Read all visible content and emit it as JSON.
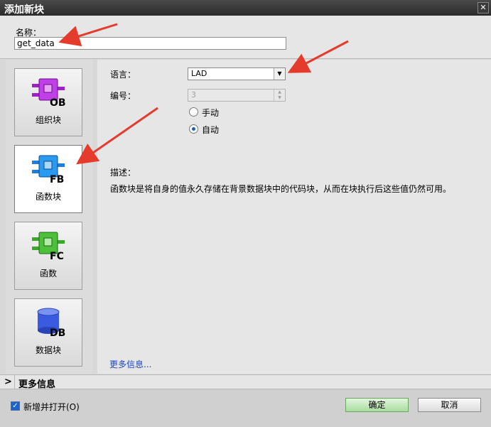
{
  "dialog": {
    "title": "添加新块",
    "close_glyph": "✕"
  },
  "name": {
    "label": "名称：",
    "value": "get_data"
  },
  "blocks": [
    {
      "label": "组织块",
      "code": "OB",
      "color": "#a020c8"
    },
    {
      "label": "函数块",
      "code": "FB",
      "color": "#1e7ee0",
      "selected": true
    },
    {
      "label": "函数",
      "code": "FC",
      "color": "#3aa82a"
    },
    {
      "label": "数据块",
      "code": "DB",
      "color": "#3a5ae0"
    }
  ],
  "form": {
    "language_label": "语言：",
    "language_value": "LAD",
    "number_label": "编号：",
    "number_value": "3",
    "manual_label": "手动",
    "auto_label": "自动",
    "selected_mode": "auto"
  },
  "description": {
    "label": "描述：",
    "text": "函数块是将自身的值永久存储在背景数据块中的代码块，从而在块执行后这些值仍然可用。"
  },
  "more_info_link": "更多信息...",
  "more_info_bar": {
    "chevron": ">",
    "title": "更多信息"
  },
  "footer": {
    "add_and_open_label": "新增并打开(O)",
    "add_and_open_checked": true,
    "ok_label": "确定",
    "cancel_label": "取消"
  },
  "colors": {
    "annotation_arrow": "#e53b2c",
    "ok_button": "#a9dc9f"
  }
}
